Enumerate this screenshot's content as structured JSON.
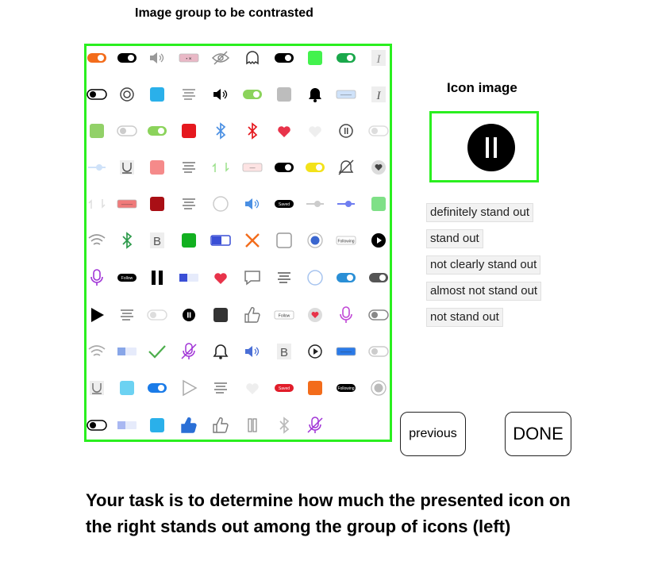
{
  "group_title": "Image group to be contrasted",
  "icon_title": "Icon image",
  "target_icon": {
    "icon": "pause-icon",
    "color": "#000000"
  },
  "frame_color": "#2aef1f",
  "options": [
    {
      "label": "definitely stand out"
    },
    {
      "label": "stand out"
    },
    {
      "label": "not clearly stand out"
    },
    {
      "label": "almost not stand out"
    },
    {
      "label": "not stand out"
    }
  ],
  "buttons": {
    "previous": "previous",
    "done": "DONE"
  },
  "instructions": "Your task is to determine how much the presented icon on the right stands out among the group of icons (left)",
  "grid": [
    [
      {
        "t": "toggle-on",
        "c": "#f36c1b"
      },
      {
        "t": "toggle-on",
        "c": "#000000"
      },
      {
        "t": "speaker",
        "c": "#999999"
      },
      {
        "t": "button",
        "c": "#e9b8c6",
        "tx": "• ✕"
      },
      {
        "t": "eye-slash",
        "c": "#888888"
      },
      {
        "t": "ghost",
        "c": "#333333"
      },
      {
        "t": "toggle-on",
        "c": "#000000"
      },
      {
        "t": "square",
        "c": "#43f24d"
      },
      {
        "t": "toggle-on",
        "c": "#1aa84b"
      },
      {
        "t": "italic",
        "c": "#888888"
      }
    ],
    [
      {
        "t": "toggle-off",
        "c": "#000000"
      },
      {
        "t": "target",
        "c": "#444444"
      },
      {
        "t": "square",
        "c": "#2ab0ea"
      },
      {
        "t": "lines",
        "c": "#888888"
      },
      {
        "t": "speaker",
        "c": "#000000"
      },
      {
        "t": "toggle-on",
        "c": "#8bd35b"
      },
      {
        "t": "square",
        "c": "#bdbdbd"
      },
      {
        "t": "bell-fill",
        "c": "#000000"
      },
      {
        "t": "button",
        "c": "#cfe2f9",
        "tx": "────"
      },
      {
        "t": "italic",
        "c": "#555555"
      }
    ],
    [
      {
        "t": "square",
        "c": "#92d168"
      },
      {
        "t": "toggle-off",
        "c": "#cccccc"
      },
      {
        "t": "toggle-on",
        "c": "#8bd35b"
      },
      {
        "t": "square",
        "c": "#e5181e"
      },
      {
        "t": "bluetooth",
        "c": "#4a8fe3"
      },
      {
        "t": "bluetooth",
        "c": "#e5181e"
      },
      {
        "t": "heart",
        "c": "#e8334a"
      },
      {
        "t": "heart",
        "c": "#eeeeee"
      },
      {
        "t": "pause-circle-outline",
        "c": "#444444"
      },
      {
        "t": "toggle-off",
        "c": "#dddddd"
      }
    ],
    [
      {
        "t": "slider",
        "c": "#cfe2f9"
      },
      {
        "t": "magnet",
        "c": "#555555"
      },
      {
        "t": "square",
        "c": "#f58a8a"
      },
      {
        "t": "lines",
        "c": "#777777"
      },
      {
        "t": "sync",
        "c": "#9be08b"
      },
      {
        "t": "button",
        "c": "#fde3e3",
        "tx": "──"
      },
      {
        "t": "toggle-on",
        "c": "#000000"
      },
      {
        "t": "toggle-on",
        "c": "#f3e21a"
      },
      {
        "t": "bell-slash",
        "c": "#444444"
      },
      {
        "t": "heart-badge",
        "c": "#444444"
      }
    ],
    [
      {
        "t": "sync",
        "c": "#dddddd"
      },
      {
        "t": "button",
        "c": "#f07a7a",
        "tx": "────"
      },
      {
        "t": "square",
        "c": "#a90f15"
      },
      {
        "t": "lines",
        "c": "#777777"
      },
      {
        "t": "circle-outline",
        "c": "#cccccc"
      },
      {
        "t": "speaker",
        "c": "#4a8fe3"
      },
      {
        "t": "pill",
        "c": "#000000",
        "tx": "Saved"
      },
      {
        "t": "slider",
        "c": "#cccccc"
      },
      {
        "t": "slider",
        "c": "#6f7ef0"
      },
      {
        "t": "square",
        "c": "#7fe087"
      }
    ],
    [
      {
        "t": "wifi",
        "c": "#999999"
      },
      {
        "t": "bluetooth",
        "c": "#2c9a4a"
      },
      {
        "t": "letter-b",
        "c": "#555555"
      },
      {
        "t": "square",
        "c": "#12b020"
      },
      {
        "t": "toggle-blue",
        "c": "#3a4fd6"
      },
      {
        "t": "cross",
        "c": "#f36c1b"
      },
      {
        "t": "square-outline",
        "c": "#999999"
      },
      {
        "t": "radio",
        "c": "#3a66cf"
      },
      {
        "t": "button",
        "c": "#ffffff",
        "tx": "Following"
      },
      {
        "t": "play-circle",
        "c": "#000000"
      }
    ],
    [
      {
        "t": "mic",
        "c": "#a033d6"
      },
      {
        "t": "pill",
        "c": "#000000",
        "tx": "Follow"
      },
      {
        "t": "pause-bars",
        "c": "#000000"
      },
      {
        "t": "slider-box",
        "c": "#3a4fd6"
      },
      {
        "t": "heart",
        "c": "#e8334a"
      },
      {
        "t": "comment",
        "c": "#777777"
      },
      {
        "t": "lines",
        "c": "#555555"
      },
      {
        "t": "circle-outline",
        "c": "#a7c4ef"
      },
      {
        "t": "toggle-on",
        "c": "#2a8fd6"
      },
      {
        "t": "toggle-on",
        "c": "#555555"
      }
    ],
    [
      {
        "t": "play",
        "c": "#000000"
      },
      {
        "t": "lines",
        "c": "#777777"
      },
      {
        "t": "toggle-off",
        "c": "#dddddd"
      },
      {
        "t": "pause-circle",
        "c": "#000000"
      },
      {
        "t": "square",
        "c": "#333333"
      },
      {
        "t": "thumb",
        "c": "#777777"
      },
      {
        "t": "button",
        "c": "#ffffff",
        "tx": "Follow"
      },
      {
        "t": "heart-badge",
        "c": "#e8334a"
      },
      {
        "t": "mic",
        "c": "#c045d6"
      },
      {
        "t": "toggle-off",
        "c": "#888888"
      }
    ],
    [
      {
        "t": "wifi",
        "c": "#aaaaaa"
      },
      {
        "t": "slider-box",
        "c": "#88a6e8"
      },
      {
        "t": "check",
        "c": "#4cae4c"
      },
      {
        "t": "mic-slash",
        "c": "#a033d6"
      },
      {
        "t": "bell",
        "c": "#222222"
      },
      {
        "t": "speaker",
        "c": "#4a6fd6"
      },
      {
        "t": "letter-b",
        "c": "#555555"
      },
      {
        "t": "play-circle-outline",
        "c": "#222222"
      },
      {
        "t": "button",
        "c": "#2a7ae8",
        "tx": "────"
      },
      {
        "t": "toggle-off",
        "c": "#cccccc"
      }
    ],
    [
      {
        "t": "magnet",
        "c": "#777777"
      },
      {
        "t": "square",
        "c": "#6cd2f2"
      },
      {
        "t": "toggle-on",
        "c": "#1a7be8"
      },
      {
        "t": "play-outline",
        "c": "#aaaaaa"
      },
      {
        "t": "lines",
        "c": "#777777"
      },
      {
        "t": "heart",
        "c": "#eeeeee"
      },
      {
        "t": "pill",
        "c": "#e11d2a",
        "tx": "Saved"
      },
      {
        "t": "square",
        "c": "#f36c1b"
      },
      {
        "t": "pill",
        "c": "#000000",
        "tx": "Following"
      },
      {
        "t": "radio",
        "c": "#bbbbbb"
      }
    ],
    [
      {
        "t": "toggle-off",
        "c": "#000000"
      },
      {
        "t": "slider-box",
        "c": "#a9b8f2"
      },
      {
        "t": "square",
        "c": "#2ab0ea"
      },
      {
        "t": "thumb",
        "c": "#2a6fd6"
      },
      {
        "t": "thumb",
        "c": "#777777"
      },
      {
        "t": "pause-bars-outline",
        "c": "#888888"
      },
      {
        "t": "bluetooth",
        "c": "#bbbbbb"
      },
      {
        "t": "mic-slash",
        "c": "#a033d6"
      }
    ]
  ]
}
